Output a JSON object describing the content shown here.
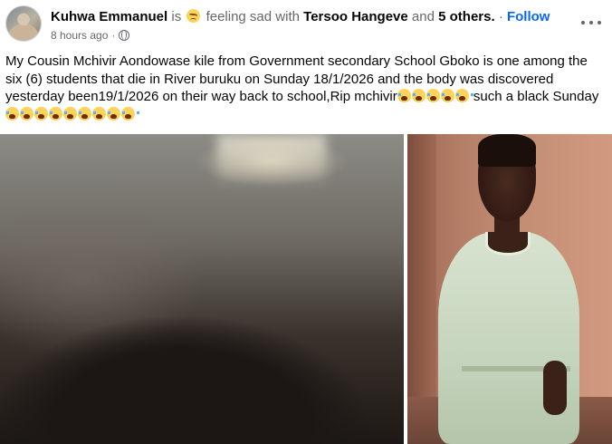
{
  "post": {
    "author": "Kuhwa Emmanuel",
    "is_text": "is",
    "feeling_text": "feeling sad with",
    "tagged_person": "Tersoo Hangeve",
    "and_text": "and",
    "others": "5 others.",
    "separator": "·",
    "follow_label": "Follow",
    "timestamp": "8 hours ago",
    "meta_dot": "·",
    "privacy_icon": "globe-icon",
    "more_icon": "more-options-icon",
    "body_text_1": "My Cousin Mchivir Aondowase kile from Government secondary School Gboko is one among the six (6) students that die in River buruku on Sunday 18/1/2026 and the body was discovered yesterday been19/1/2026 on their way back to school,Rip mchivir",
    "body_text_2": " such a black Sunday ",
    "emoji_icon": "crying-face-emoji",
    "feeling_emoji": "sad-face-emoji"
  },
  "colors": {
    "link_blue": "#0866ff",
    "muted_gray": "#65676b",
    "text": "#050505"
  }
}
